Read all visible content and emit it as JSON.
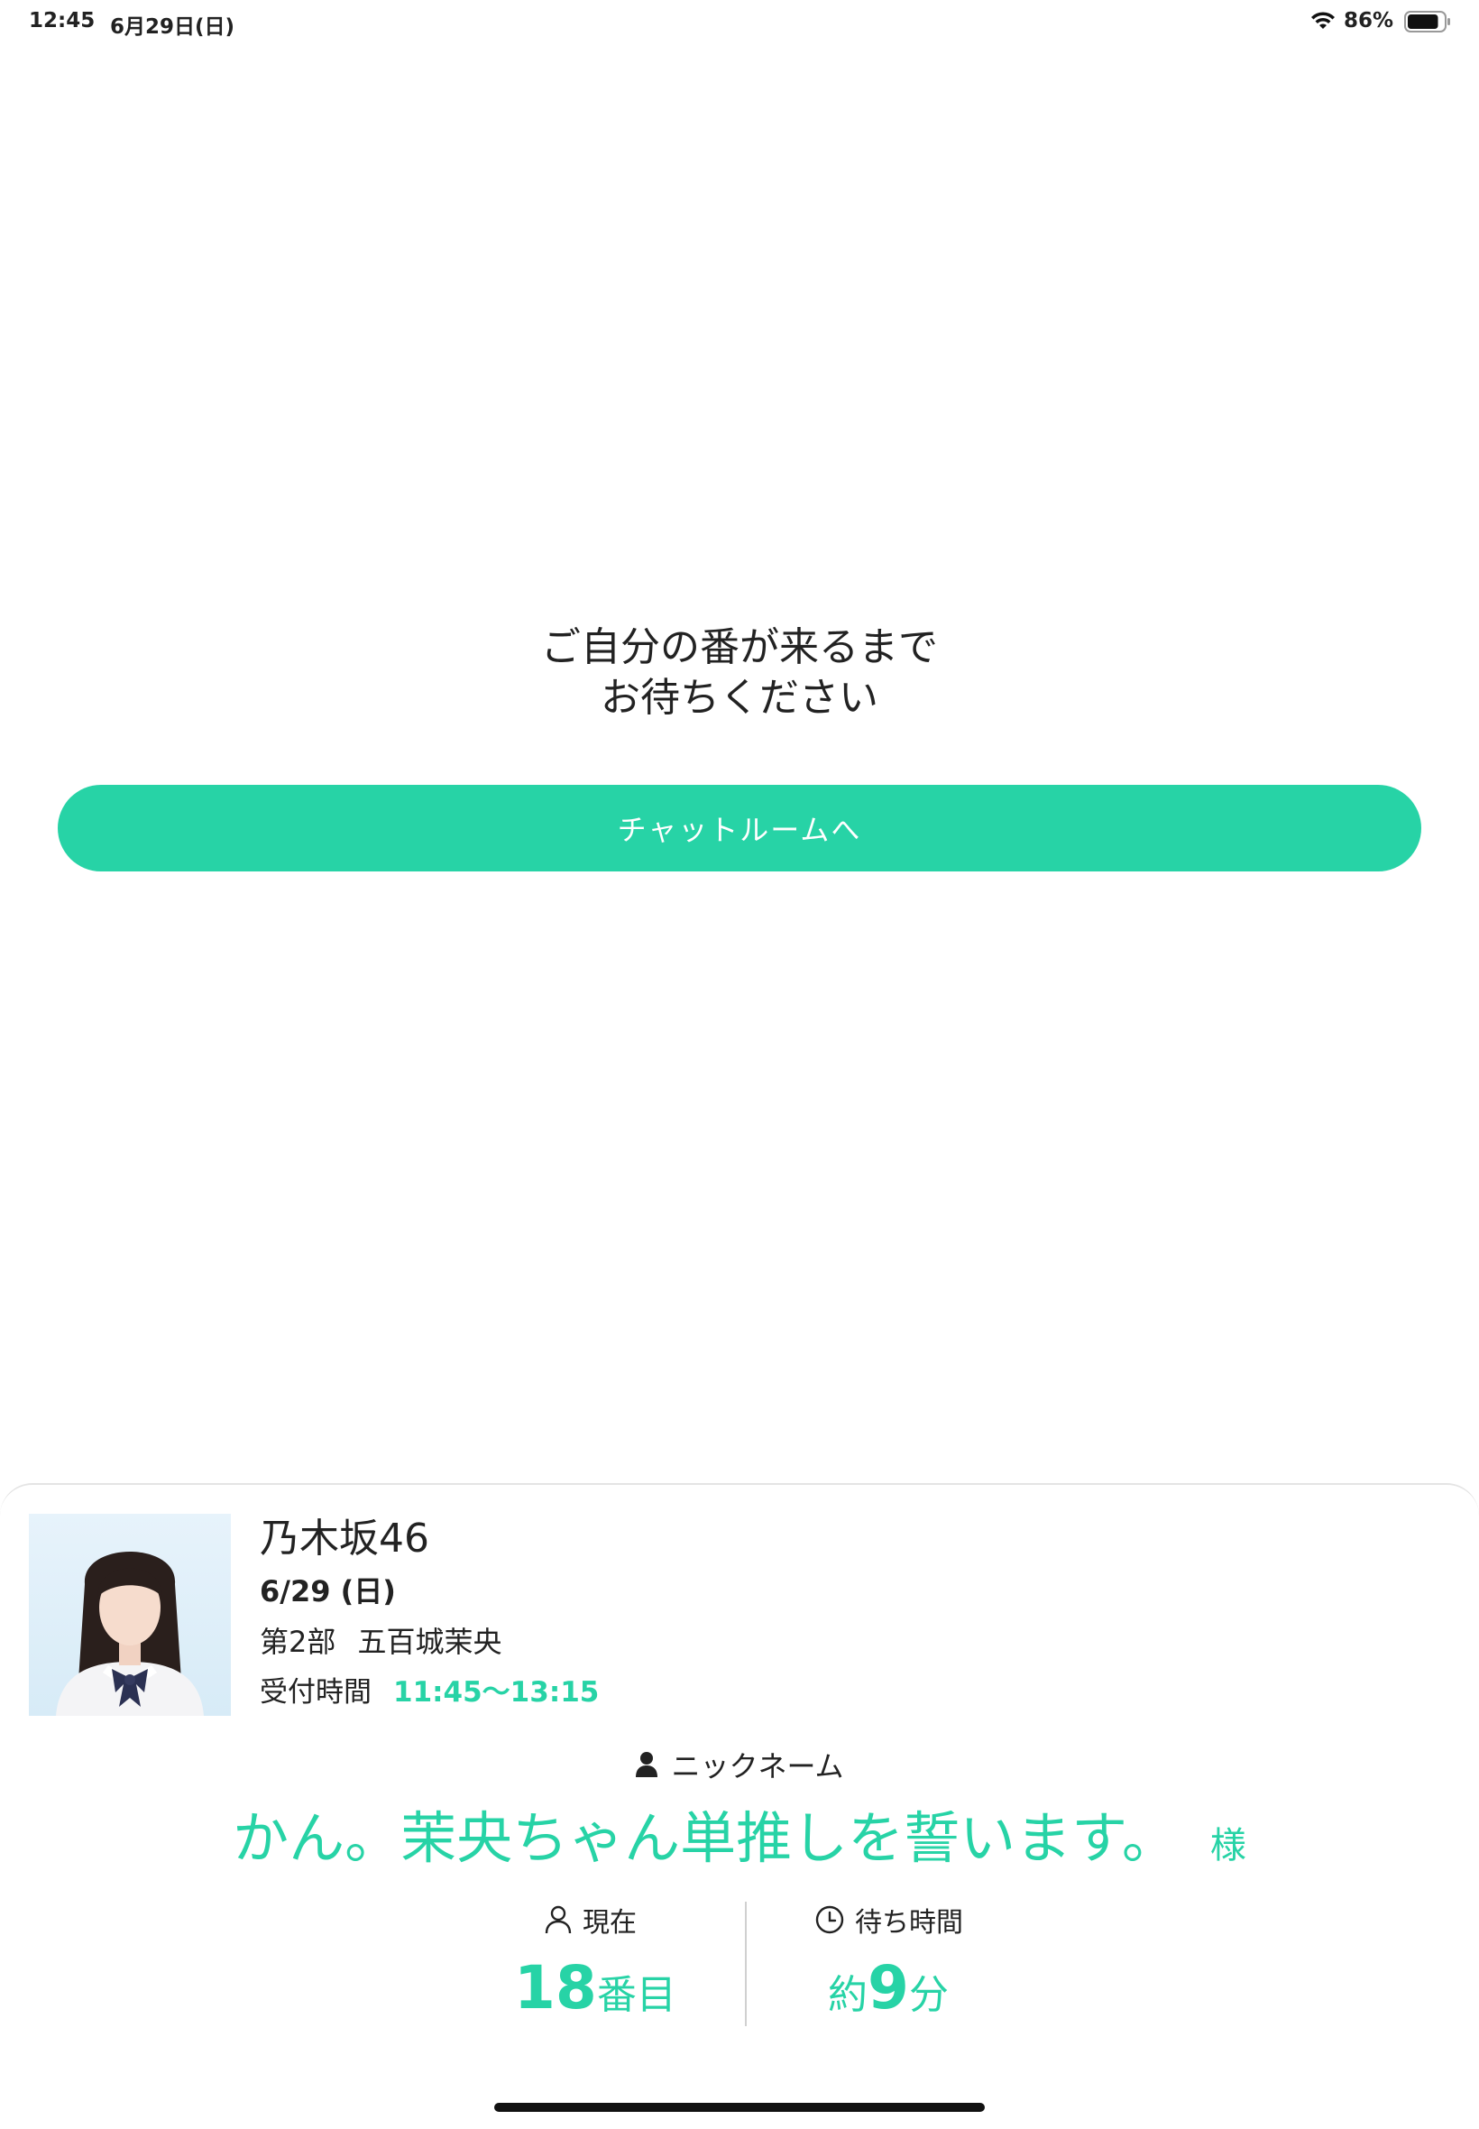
{
  "status_bar": {
    "time": "12:45",
    "date": "6月29日(日)",
    "battery_percent": "86%",
    "battery_level": 0.86
  },
  "main": {
    "wait_message_line1": "ご自分の番が来るまで",
    "wait_message_line2": "お待ちください",
    "chat_button_label": "チャットルームへ"
  },
  "ticket": {
    "group_name": "乃木坂46",
    "date": "6/29 (日)",
    "session": "第2部",
    "member": "五百城茉央",
    "reception_label": "受付時間",
    "reception_time": "11:45〜13:15",
    "nickname_label": "ニックネーム",
    "nickname": "かん。茉央ちゃん単推しを誓います。",
    "nickname_suffix": "様",
    "current_label": "現在",
    "position_number": "18",
    "position_unit": "番目",
    "wait_label": "待ち時間",
    "wait_prefix": "約",
    "wait_number": "9",
    "wait_unit": "分"
  },
  "colors": {
    "accent": "#27d3a6",
    "text": "#222222",
    "divider": "#d0d0d0"
  },
  "icons": [
    "wifi-icon",
    "battery-icon",
    "person-icon",
    "person-outline-icon",
    "clock-icon"
  ]
}
